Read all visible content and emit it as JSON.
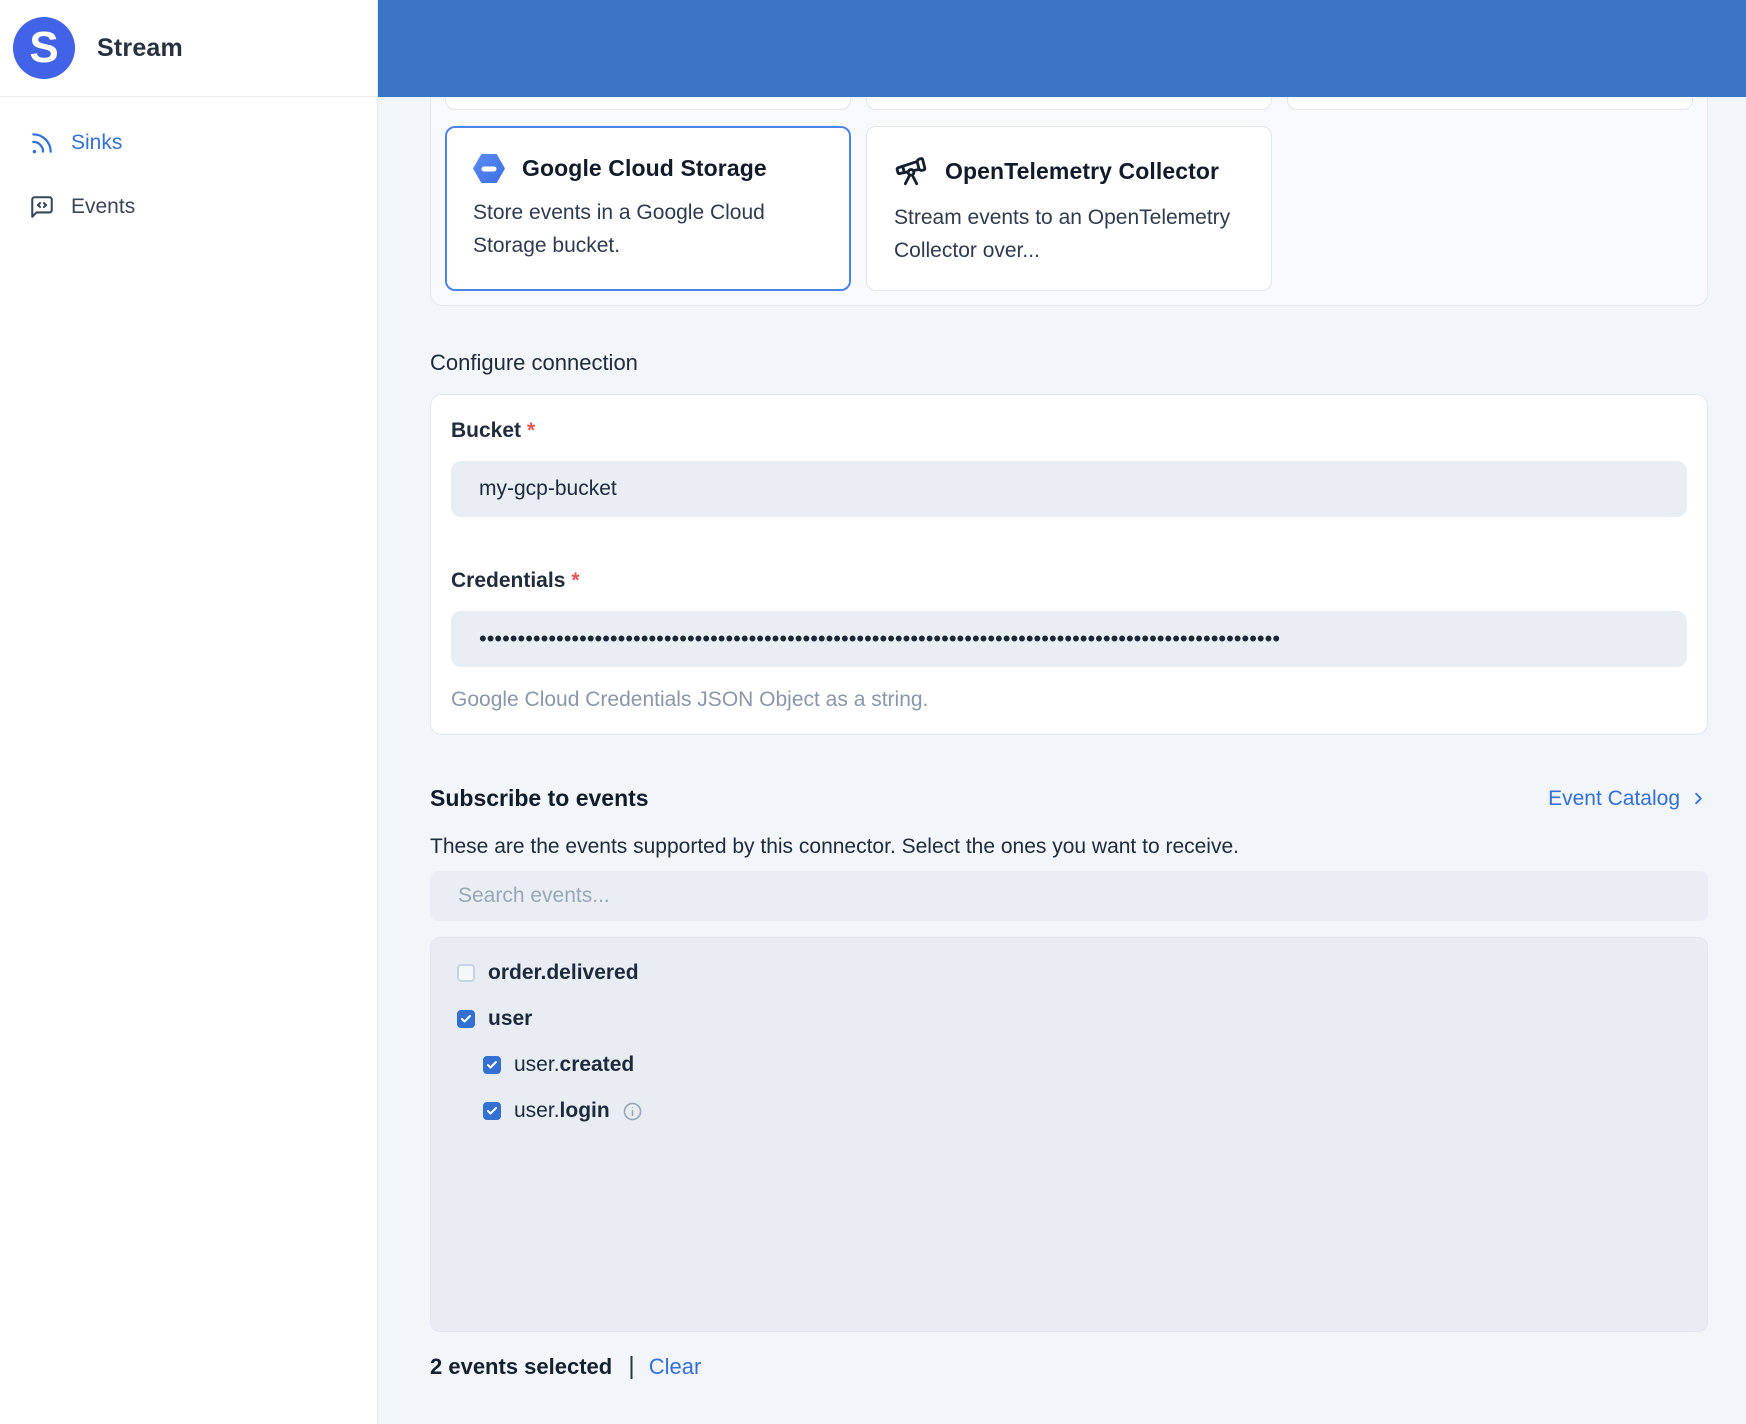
{
  "sidebar": {
    "logo_letter": "S",
    "logo_text": "Stream",
    "items": [
      {
        "label": "Sinks",
        "icon": "rss-icon",
        "active": true
      },
      {
        "label": "Events",
        "icon": "message-square-icon",
        "active": false
      }
    ]
  },
  "connectors": {
    "cards": [
      {
        "title": "Google Cloud Storage",
        "description": "Store events in a Google Cloud Storage bucket.",
        "icon": "google-cloud-storage-icon",
        "selected": true
      },
      {
        "title": "OpenTelemetry Collector",
        "description": "Stream events to an OpenTelemetry Collector over...",
        "icon": "telescope-icon",
        "selected": false
      }
    ]
  },
  "configure": {
    "heading": "Configure connection",
    "required_marker": "*",
    "fields": [
      {
        "label": "Bucket",
        "required": true,
        "value": "my-gcp-bucket"
      },
      {
        "label": "Credentials",
        "required": true,
        "value_masked": "••••••••••••••••••••••••••••••••••••••••••••••••••••••••••••••••••••••••••••••••••••••••••••••••••••••••",
        "help": "Google Cloud Credentials JSON Object as a string."
      }
    ]
  },
  "subscribe": {
    "heading": "Subscribe to events",
    "catalog_link_label": "Event Catalog",
    "description": "These are the events supported by this connector. Select the ones you want to receive.",
    "search_placeholder": "Search events...",
    "events": [
      {
        "prefix": "",
        "name": "order.delivered",
        "checked": false,
        "child": false,
        "info": false
      },
      {
        "prefix": "",
        "name": "user",
        "checked": true,
        "child": false,
        "info": false
      },
      {
        "prefix": "user.",
        "name": "created",
        "checked": true,
        "child": true,
        "info": false
      },
      {
        "prefix": "user.",
        "name": "login",
        "checked": true,
        "child": true,
        "info": true
      }
    ],
    "selected_summary": "2 events selected",
    "separator": "|",
    "clear_label": "Clear"
  },
  "colors": {
    "topbar_blue": "#3e74c6",
    "logo_blue": "#4163e8",
    "link_blue": "#3570d6",
    "checkbox_blue": "#3470d1",
    "selected_card_border": "#4f83e8",
    "required_red": "#e25555",
    "page_background": "#f2f5f9",
    "input_background": "#e9eef4"
  }
}
